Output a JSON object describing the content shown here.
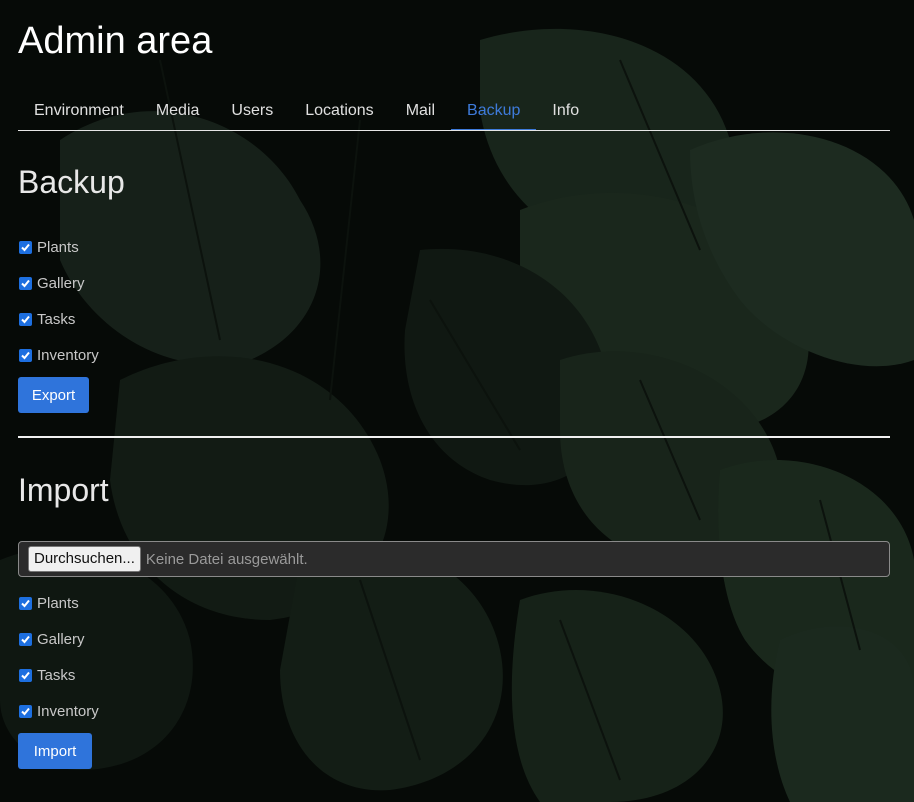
{
  "page": {
    "title": "Admin area"
  },
  "tabs": [
    {
      "label": "Environment",
      "active": false
    },
    {
      "label": "Media",
      "active": false
    },
    {
      "label": "Users",
      "active": false
    },
    {
      "label": "Locations",
      "active": false
    },
    {
      "label": "Mail",
      "active": false
    },
    {
      "label": "Backup",
      "active": true
    },
    {
      "label": "Info",
      "active": false
    }
  ],
  "backup": {
    "heading": "Backup",
    "options": [
      {
        "label": "Plants",
        "checked": true
      },
      {
        "label": "Gallery",
        "checked": true
      },
      {
        "label": "Tasks",
        "checked": true
      },
      {
        "label": "Inventory",
        "checked": true
      }
    ],
    "button_label": "Export"
  },
  "import": {
    "heading": "Import",
    "file_button_label": "Durchsuchen...",
    "file_status": "Keine Datei ausgewählt.",
    "options": [
      {
        "label": "Plants",
        "checked": true
      },
      {
        "label": "Gallery",
        "checked": true
      },
      {
        "label": "Tasks",
        "checked": true
      },
      {
        "label": "Inventory",
        "checked": true
      }
    ],
    "button_label": "Import"
  },
  "colors": {
    "accent": "#2f74db",
    "active_tab": "#3e7bdb",
    "background": "#070b08"
  },
  "icons": {
    "checkbox": "checkmark-icon"
  }
}
